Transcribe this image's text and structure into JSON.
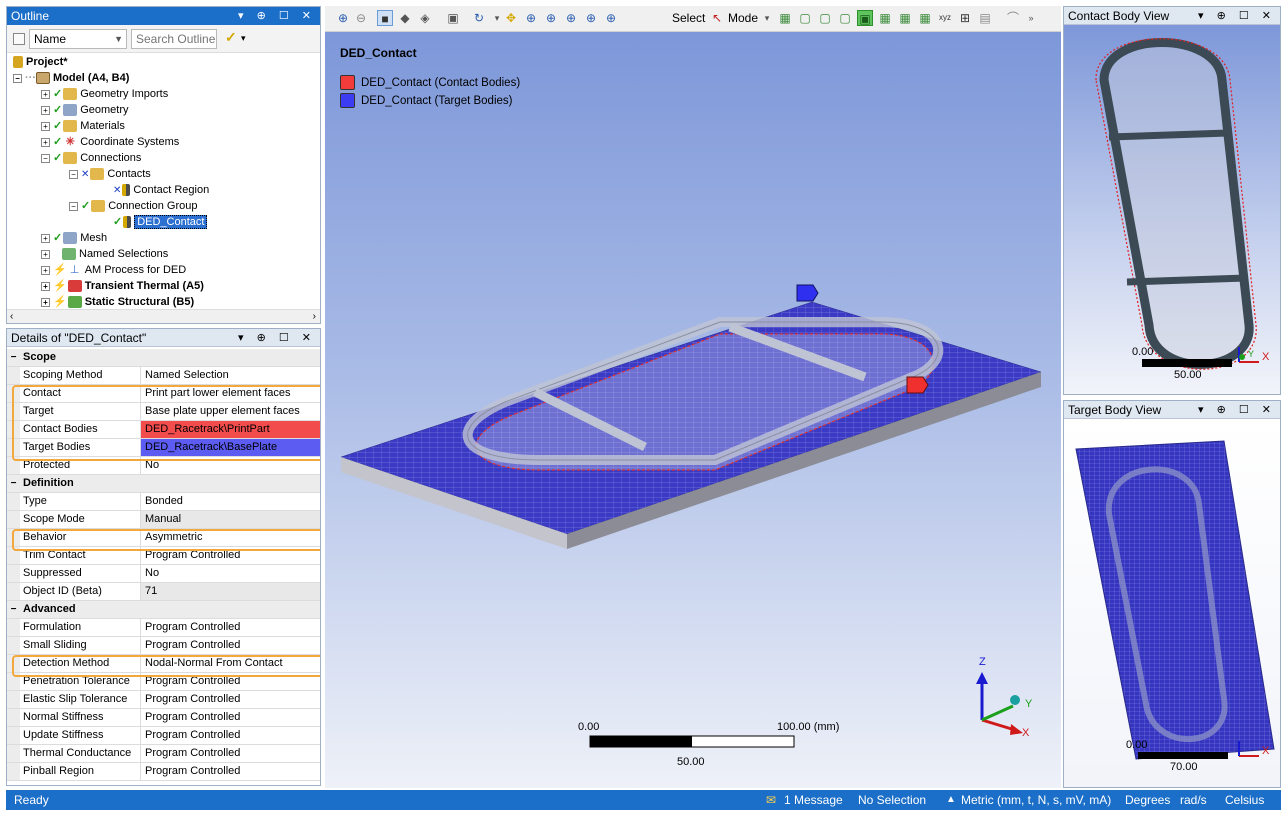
{
  "outline": {
    "title": "Outline",
    "name_filter": "Name",
    "search_placeholder": "Search Outline",
    "tree": {
      "project": "Project*",
      "model": "Model (A4, B4)",
      "geometry_imports": "Geometry Imports",
      "geometry": "Geometry",
      "materials": "Materials",
      "coordinate_systems": "Coordinate Systems",
      "connections": "Connections",
      "contacts": "Contacts",
      "contact_region": "Contact Region",
      "connection_group": "Connection Group",
      "ded_contact": "DED_Contact",
      "mesh": "Mesh",
      "named_selections": "Named Selections",
      "am_process": "AM Process for DED",
      "transient_thermal": "Transient Thermal (A5)",
      "static_structural": "Static Structural (B5)"
    }
  },
  "details": {
    "title": "Details of \"DED_Contact\"",
    "sections": {
      "scope": "Scope",
      "definition": "Definition",
      "advanced": "Advanced"
    },
    "rows": {
      "scoping_method": {
        "k": "Scoping Method",
        "v": "Named Selection"
      },
      "contact": {
        "k": "Contact",
        "v": "Print part lower element faces"
      },
      "target": {
        "k": "Target",
        "v": "Base plate upper element faces"
      },
      "contact_bodies": {
        "k": "Contact Bodies",
        "v": "DED_Racetrack\\PrintPart"
      },
      "target_bodies": {
        "k": "Target Bodies",
        "v": "DED_Racetrack\\BasePlate"
      },
      "protected": {
        "k": "Protected",
        "v": "No"
      },
      "type": {
        "k": "Type",
        "v": "Bonded"
      },
      "scope_mode": {
        "k": "Scope Mode",
        "v": "Manual"
      },
      "behavior": {
        "k": "Behavior",
        "v": "Asymmetric"
      },
      "trim_contact": {
        "k": "Trim Contact",
        "v": "Program Controlled"
      },
      "suppressed": {
        "k": "Suppressed",
        "v": "No"
      },
      "object_id": {
        "k": "Object ID (Beta)",
        "v": "71"
      },
      "formulation": {
        "k": "Formulation",
        "v": "Program Controlled"
      },
      "small_sliding": {
        "k": "Small Sliding",
        "v": "Program Controlled"
      },
      "detection_method": {
        "k": "Detection Method",
        "v": "Nodal-Normal From Contact"
      },
      "penetration_tolerance": {
        "k": "Penetration Tolerance",
        "v": "Program Controlled"
      },
      "elastic_slip_tolerance": {
        "k": "Elastic Slip Tolerance",
        "v": "Program Controlled"
      },
      "normal_stiffness": {
        "k": "Normal Stiffness",
        "v": "Program Controlled"
      },
      "update_stiffness": {
        "k": "Update Stiffness",
        "v": "Program Controlled"
      },
      "thermal_conductance": {
        "k": "Thermal Conductance",
        "v": "Program Controlled"
      },
      "pinball_region": {
        "k": "Pinball Region",
        "v": "Program Controlled"
      }
    },
    "highlight_color": "#f2a83c",
    "contact_color": "#f24c4c",
    "target_color": "#5c5cf2"
  },
  "toolbar": {
    "select_label": "Select",
    "mode_label": "Mode"
  },
  "viewport": {
    "title": "DED_Contact",
    "legend_contact": "DED_Contact (Contact Bodies)",
    "legend_target": "DED_Contact (Target Bodies)",
    "scale_start": "0.00",
    "scale_end": "100.00 (mm)",
    "scale_mid": "50.00",
    "axis_z": "Z",
    "axis_y": "Y",
    "axis_x": "X"
  },
  "contact_view": {
    "title": "Contact Body View",
    "scale_start": "0.00",
    "scale_mid": "50.00",
    "axis_y": "Y",
    "axis_x": "X"
  },
  "target_view": {
    "title": "Target Body View",
    "scale_start": "0.00",
    "scale_mid": "70.00",
    "axis_x": "X"
  },
  "status": {
    "ready": "Ready",
    "messages": "1 Message",
    "selection": "No Selection",
    "units": "Metric (mm, t, N, s, mV, mA)",
    "angle": "Degrees",
    "rate": "rad/s",
    "temp": "Celsius"
  }
}
